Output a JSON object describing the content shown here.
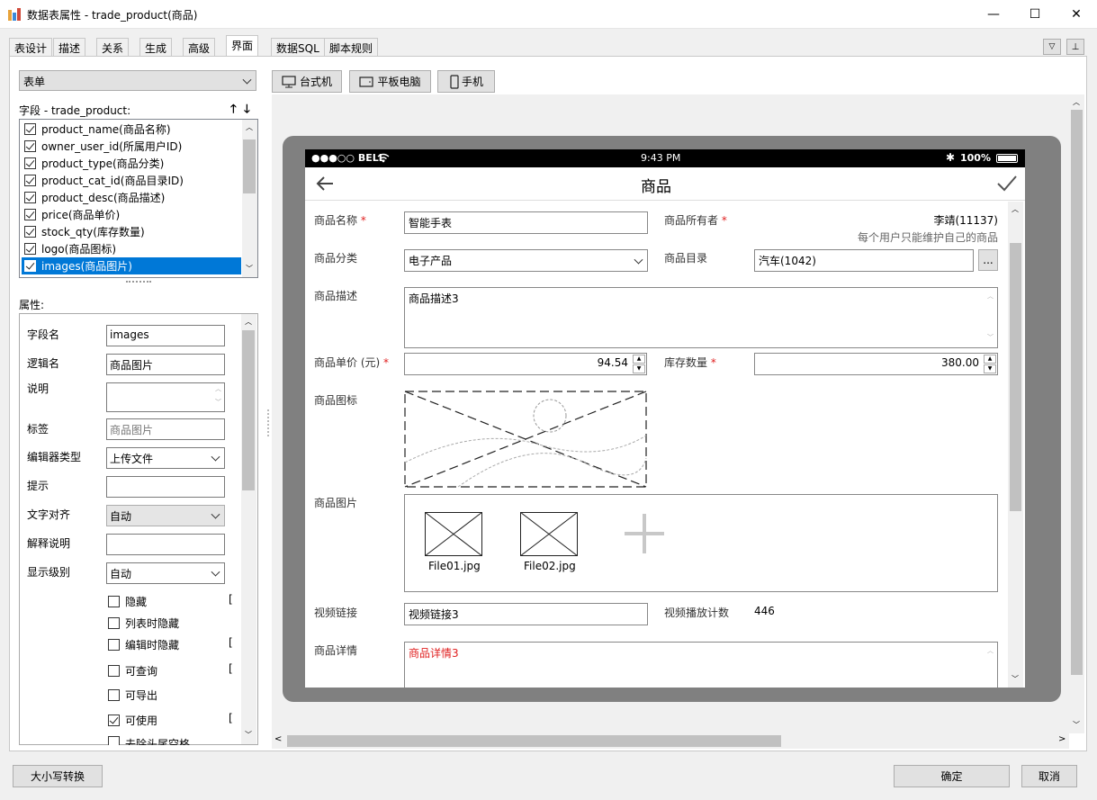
{
  "window": {
    "title": "数据表属性 - trade_product(商品)",
    "minimize": "—",
    "maximize": "☐",
    "close": "✕"
  },
  "tabs": [
    {
      "label": "表设计"
    },
    {
      "label": "描述"
    },
    {
      "label": "关系"
    },
    {
      "label": "生成"
    },
    {
      "label": "高级"
    },
    {
      "label": "界面"
    },
    {
      "label": "数据SQL"
    },
    {
      "label": "脚本规则"
    }
  ],
  "left": {
    "form_type": "表单",
    "fields_header": "字段 - trade_product:",
    "fields": [
      {
        "label": "product_name(商品名称)",
        "checked": true
      },
      {
        "label": "owner_user_id(所属用户ID)",
        "checked": true
      },
      {
        "label": "product_type(商品分类)",
        "checked": true
      },
      {
        "label": "product_cat_id(商品目录ID)",
        "checked": true
      },
      {
        "label": "product_desc(商品描述)",
        "checked": true
      },
      {
        "label": "price(商品单价)",
        "checked": true
      },
      {
        "label": "stock_qty(库存数量)",
        "checked": true
      },
      {
        "label": "logo(商品图标)",
        "checked": true
      },
      {
        "label": "images(商品图片)",
        "checked": true,
        "selected": true
      }
    ],
    "props_header": "属性:",
    "props": {
      "field_name_label": "字段名",
      "field_name": "images",
      "logic_name_label": "逻辑名",
      "logic_name": "商品图片",
      "desc_label": "说明",
      "desc": "",
      "tag_label": "标签",
      "tag_placeholder": "商品图片",
      "editor_label": "编辑器类型",
      "editor": "上传文件",
      "hint_label": "提示",
      "hint": "",
      "align_label": "文字对齐",
      "align": "自动",
      "explain_label": "解释说明",
      "explain": "",
      "level_label": "显示级别",
      "level": "自动"
    },
    "checks": [
      {
        "label": "隐藏",
        "checked": false
      },
      {
        "label": "列表时隐藏",
        "checked": false
      },
      {
        "label": "编辑时隐藏",
        "checked": false
      },
      {
        "label": "可查询",
        "checked": false
      },
      {
        "label": "可导出",
        "checked": false
      },
      {
        "label": "可使用",
        "checked": true
      },
      {
        "label": "去除头尾空格",
        "checked": false
      }
    ]
  },
  "device_buttons": [
    {
      "label": "台式机"
    },
    {
      "label": "平板电脑"
    },
    {
      "label": "手机"
    }
  ],
  "phone": {
    "status_carrier": "●●●○○ BELL",
    "status_time": "9:43 PM",
    "status_battery": "100%",
    "nav_title": "商品",
    "form": {
      "name_label": "商品名称",
      "name": "智能手表",
      "owner_label": "商品所有者",
      "owner": "李靖(11137)",
      "owner_hint": "每个用户只能维护自己的商品",
      "type_label": "商品分类",
      "type": "电子产品",
      "cat_label": "商品目录",
      "cat": "汽车(1042)",
      "cat_btn": "...",
      "desc_label": "商品描述",
      "desc": "商品描述3",
      "price_label": "商品单价 (元)",
      "price": "94.54",
      "stock_label": "库存数量",
      "stock": "380.00",
      "logo_label": "商品图标",
      "images_label": "商品图片",
      "files": [
        {
          "name": "File01.jpg"
        },
        {
          "name": "File02.jpg"
        }
      ],
      "video_label": "视频链接",
      "video": "视频链接3",
      "plays_label": "视频播放计数",
      "plays": "446",
      "detail_label": "商品详情",
      "detail": "商品详情3"
    }
  },
  "bottom": {
    "case_btn": "大小写转换",
    "ok": "确定",
    "cancel": "取消"
  },
  "colors": {
    "selection": "#0078d7",
    "required": "#e02020",
    "phone_frame": "#808080"
  }
}
